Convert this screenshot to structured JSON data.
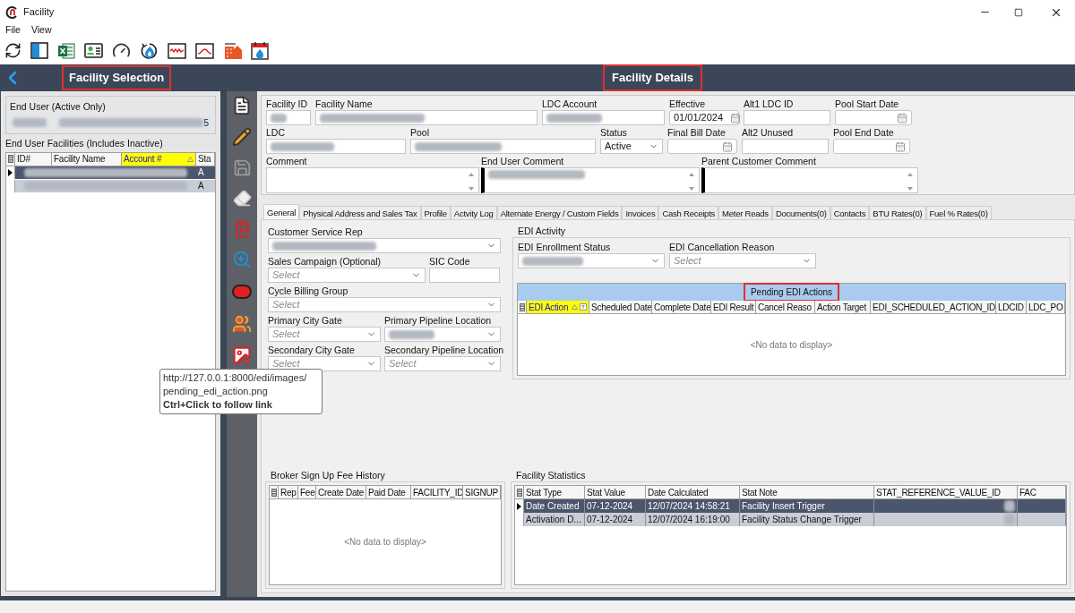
{
  "window": {
    "title": "Facility"
  },
  "menu": [
    "File",
    "View"
  ],
  "left_panel": {
    "title": "Facility Selection",
    "highlighted": true,
    "end_user": {
      "label": "End User (Active Only)",
      "fields": [
        {
          "redacted": true
        },
        {
          "redacted": true,
          "value": "5"
        }
      ]
    },
    "facilities": {
      "label": "End User Facilities (Includes Inactive)",
      "columns": [
        {
          "label": "ID#",
          "sorted": false
        },
        {
          "label": "Facility Name",
          "sorted": false
        },
        {
          "label": "Account #",
          "sorted": true
        },
        {
          "label": "Sta",
          "sorted": false
        }
      ],
      "rows": [
        {
          "selected": true,
          "redacted": true,
          "status": "A"
        },
        {
          "selected": false,
          "redacted": true,
          "status": "A"
        }
      ]
    }
  },
  "details": {
    "title": "Facility Details",
    "highlighted": true,
    "lines": [
      {
        "fields": [
          {
            "label": "Facility ID",
            "kind": "text",
            "redacted": true
          },
          {
            "label": "Facility Name",
            "kind": "text",
            "redacted": true
          },
          {
            "label": "LDC Account",
            "kind": "text",
            "redacted": true
          },
          {
            "label": "Effective",
            "kind": "date",
            "value": "01/01/2024"
          },
          {
            "label": "Alt1 LDC ID",
            "kind": "text"
          },
          {
            "label": "Pool Start Date",
            "kind": "date"
          }
        ]
      },
      {
        "fields": [
          {
            "label": "LDC",
            "kind": "text",
            "redacted": true
          },
          {
            "label": "Pool",
            "kind": "text",
            "redacted": true
          },
          {
            "label": "Status",
            "kind": "select",
            "value": "Active"
          },
          {
            "label": "Final Bill Date",
            "kind": "date"
          },
          {
            "label": "Alt2 Unused",
            "kind": "text"
          },
          {
            "label": "Pool End Date",
            "kind": "date"
          }
        ]
      },
      {
        "fields": [
          {
            "label": "Comment",
            "kind": "textarea"
          },
          {
            "label": "End User Comment",
            "kind": "textarea",
            "redacted": true
          },
          {
            "label": "Parent Customer Comment",
            "kind": "textarea"
          }
        ]
      }
    ]
  },
  "tabs": [
    {
      "label": "General",
      "selected": true
    },
    {
      "label": "Physical Address and Sales Tax",
      "selected": false
    },
    {
      "label": "Profile",
      "selected": false
    },
    {
      "label": "Actvity Log",
      "selected": false
    },
    {
      "label": "Alternate Energy / Custom Fields",
      "selected": false
    },
    {
      "label": "Invoices",
      "selected": false
    },
    {
      "label": "Cash Receipts",
      "selected": false
    },
    {
      "label": "Meter Reads",
      "selected": false
    },
    {
      "label": "Documents(0)",
      "selected": false
    },
    {
      "label": "Contacts",
      "selected": false
    },
    {
      "label": "BTU Rates(0)",
      "selected": false
    },
    {
      "label": "Fuel % Rates(0)",
      "selected": false
    }
  ],
  "general": {
    "rows": [
      [
        {
          "label": "Customer Service Rep",
          "kind": "select",
          "redacted": true
        }
      ],
      [
        {
          "label": "Sales Campaign (Optional)",
          "kind": "select",
          "placeholder": "Select"
        },
        {
          "label": "SIC Code",
          "kind": "text"
        }
      ],
      [
        {
          "label": "Cycle Billing Group",
          "kind": "select",
          "placeholder": "Select"
        }
      ],
      [
        {
          "label": "Primary City Gate",
          "kind": "select",
          "placeholder": "Select"
        },
        {
          "label": "Primary Pipeline Location",
          "kind": "select",
          "redacted": true
        }
      ],
      [
        {
          "label": "Secondary City Gate",
          "kind": "select",
          "placeholder": "Select"
        },
        {
          "label": "Secondary Pipeline Location",
          "kind": "select",
          "placeholder": "Select"
        }
      ]
    ]
  },
  "edi_activity": {
    "title": "EDI Activity",
    "fields": [
      {
        "label": "EDI Enrollment Status",
        "kind": "select",
        "redacted": true
      },
      {
        "label": "EDI Cancellation Reason",
        "kind": "select",
        "placeholder": "Select"
      }
    ],
    "grid": {
      "title": "Pending EDI Actions",
      "highlighted": true,
      "columns": [
        {
          "label": "EDI Action",
          "sorted": true
        },
        {
          "label": "Scheduled Date",
          "sorted": false
        },
        {
          "label": "Complete Date",
          "sorted": false
        },
        {
          "label": "EDI Result",
          "sorted": false
        },
        {
          "label": "Cancel Reaso",
          "sorted": false
        },
        {
          "label": "Action Target",
          "sorted": false
        },
        {
          "label": "EDI_SCHEDULED_ACTION_ID",
          "sorted": false
        },
        {
          "label": "LDCID",
          "sorted": false
        },
        {
          "label": "LDC_PO",
          "sorted": false
        }
      ],
      "empty": "<No data to display>"
    }
  },
  "broker": {
    "title": "Broker Sign Up Fee History",
    "columns": [
      {
        "label": "Rep",
        "sorted": false
      },
      {
        "label": "Fee",
        "sorted": false
      },
      {
        "label": "Create Date",
        "sorted": false
      },
      {
        "label": "Paid Date",
        "sorted": false
      },
      {
        "label": "FACILITY_ID",
        "sorted": false
      },
      {
        "label": "SIGNUP",
        "sorted": false
      }
    ],
    "empty": "<No data to display>"
  },
  "statistics": {
    "title": "Facility Statistics",
    "columns": [
      {
        "label": "Stat Type",
        "sorted": false
      },
      {
        "label": "Stat Value",
        "sorted": false
      },
      {
        "label": "Date Calculated",
        "sorted": false
      },
      {
        "label": "Stat Note",
        "sorted": false
      },
      {
        "label": "STAT_REFERENCE_VALUE_ID",
        "sorted": false
      },
      {
        "label": "FAC",
        "sorted": false
      }
    ],
    "rows": [
      {
        "selected": true,
        "redacted": true,
        "cells": [
          "Date Created",
          "07-12-2024",
          "12/07/2024 14:58:21",
          "Facility Insert Trigger"
        ]
      },
      {
        "selected": false,
        "redacted": true,
        "cells": [
          "Activation D...",
          "07-12-2024",
          "12/07/2024 16:19:00",
          "Facility Status Change Trigger"
        ]
      }
    ]
  },
  "tooltip": {
    "lines": [
      "http://127.0.0.1:8000/edi/images/",
      "pending_edi_action.png"
    ],
    "hint": "Ctrl+Click to follow link"
  }
}
